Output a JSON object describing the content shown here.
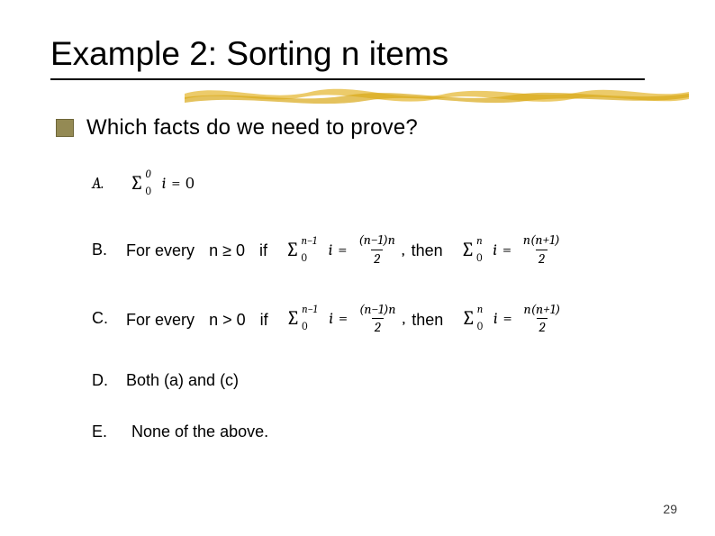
{
  "title": "Example 2: Sorting n items",
  "question": "Which facts do we need to prove?",
  "options": {
    "A": {
      "label": "A.",
      "math": {
        "sum_lower": "0",
        "sum_upper": "0",
        "term": "i",
        "eq": "=",
        "rhs": "0"
      }
    },
    "B": {
      "label": "B.",
      "prefix1": "For every",
      "cond_var": "n ≥ 0",
      "prefix2": "if",
      "lhs": {
        "sum_lower": "0",
        "sum_upper": "n−1",
        "term": "i"
      },
      "lhs_eq": "=",
      "lhs_frac": {
        "num": "(n−1)n",
        "den": "2"
      },
      "then_sep": ",",
      "then_word": "then",
      "rhs": {
        "sum_lower": "0",
        "sum_upper": "n",
        "term": "i"
      },
      "rhs_eq": "=",
      "rhs_frac": {
        "num": "n(n+1)",
        "den": "2"
      }
    },
    "C": {
      "label": "C.",
      "prefix1": "For every",
      "cond_var": "n > 0",
      "prefix2": "if",
      "lhs": {
        "sum_lower": "0",
        "sum_upper": "n−1",
        "term": "i"
      },
      "lhs_eq": "=",
      "lhs_frac": {
        "num": "(n−1)n",
        "den": "2"
      },
      "then_sep": ",",
      "then_word": "then",
      "rhs": {
        "sum_lower": "0",
        "sum_upper": "n",
        "term": "i"
      },
      "rhs_eq": "=",
      "rhs_frac": {
        "num": "n(n+1)",
        "den": "2"
      }
    },
    "D": {
      "label": "D.",
      "text": "Both (a) and (c)"
    },
    "E": {
      "label": "E.",
      "text": "None of the above."
    }
  },
  "page_number": "29"
}
